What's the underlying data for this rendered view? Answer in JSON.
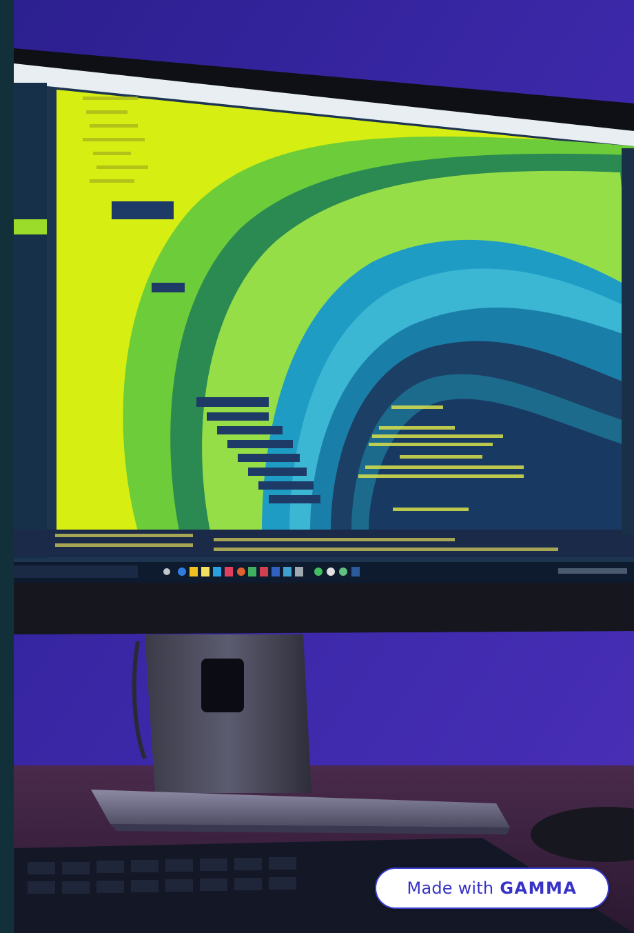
{
  "badge": {
    "prefix": "Made with",
    "brand": "GAMMA"
  },
  "colors": {
    "background_purple": "#3d2aa8",
    "screen_yellow": "#d8ef14",
    "screen_green": "#8fdc3c",
    "screen_teal": "#1e9fc2",
    "screen_navy": "#1a3f67",
    "desk": "#3a2240",
    "badge_text": "#3833c7"
  },
  "icons": [
    "taskbar-app-icons",
    "code-lines"
  ]
}
